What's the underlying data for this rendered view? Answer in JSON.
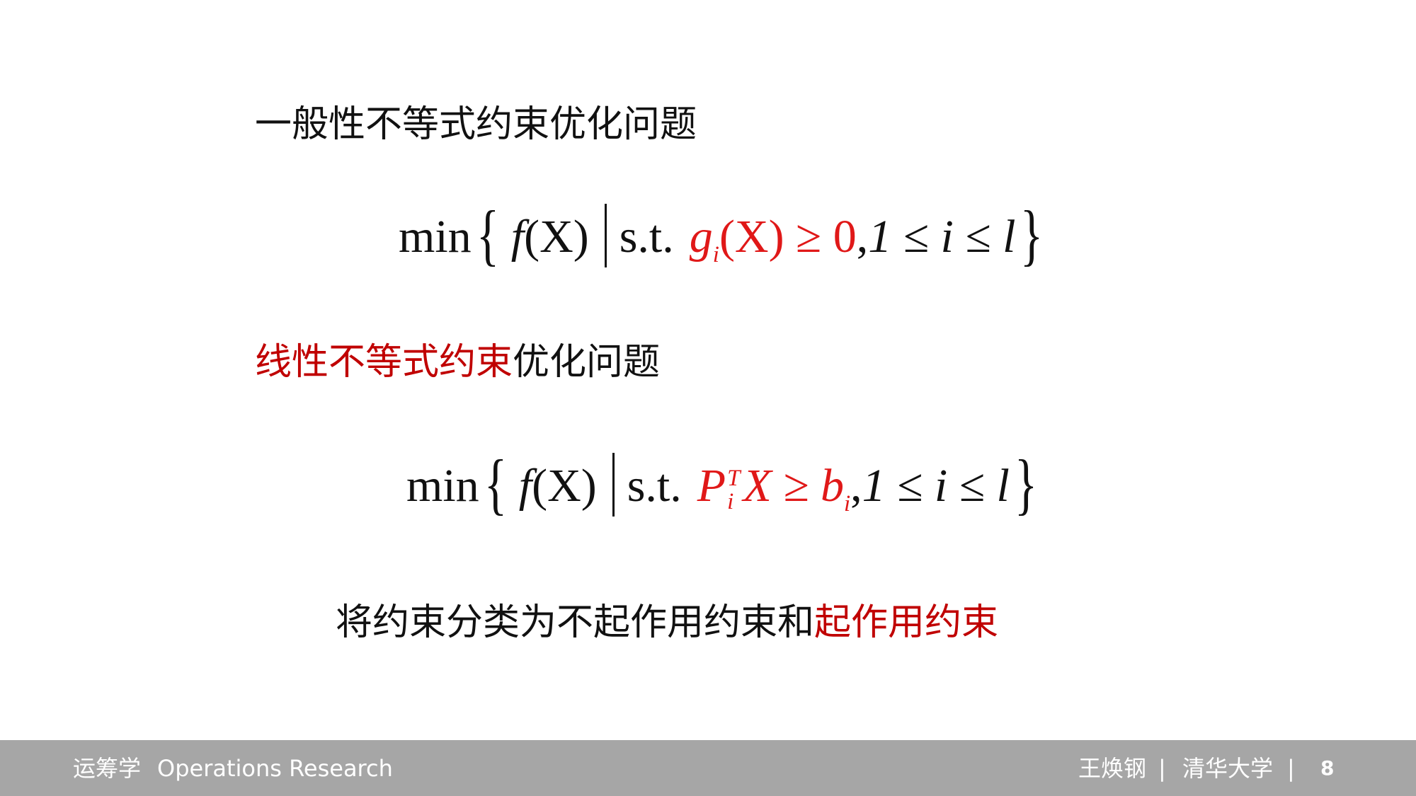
{
  "slide": {
    "heading1": "一般性不等式约束优化问题",
    "heading2_red": "线性不等式约束",
    "heading2_rest": "优化问题",
    "statement_black": "将约束分类为不起作用约束和",
    "statement_red": "起作用约束"
  },
  "formula1": {
    "min": "min",
    "open_brace": "{",
    "f": "f",
    "fX": "(X)",
    "st": "s.t.",
    "g": "g",
    "g_sub": "i",
    "constraint": "(X) ≥ 0",
    "range_sep": ",",
    "range": "1 ≤ i ≤ l",
    "close_brace": "}"
  },
  "formula2": {
    "min": "min",
    "open_brace": "{",
    "f": "f",
    "fX": "(X)",
    "st": "s.t.",
    "P": "P",
    "P_sup": "T",
    "P_sub": "i",
    "XgeB": "X ≥ b",
    "b_sub": "i",
    "range_sep": ",",
    "range": "1 ≤ i ≤ l",
    "close_brace": "}"
  },
  "footer": {
    "course": "运筹学",
    "course_en": "Operations Research",
    "author": "王焕钢",
    "sep1": "|",
    "university": "清华大学",
    "sep2": "|",
    "page": "8"
  },
  "colors": {
    "red_text": "#c00000",
    "red_math": "#e01818",
    "footer_bg": "#a6a6a6"
  }
}
